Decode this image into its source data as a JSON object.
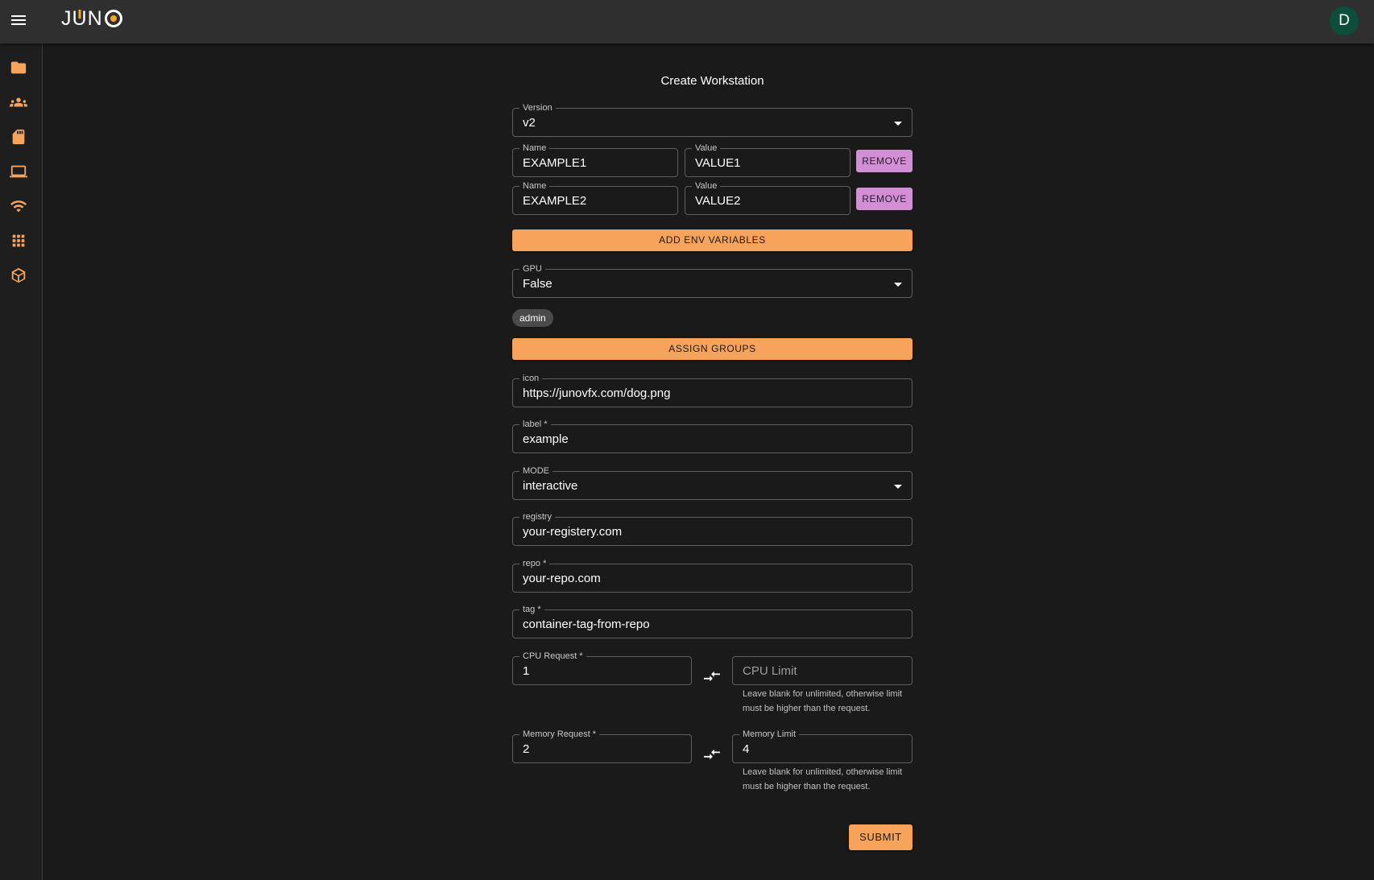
{
  "app": {
    "logo_text": "JUNO",
    "avatar_initial": "D"
  },
  "sidebar": {
    "items": [
      {
        "icon": "folder-icon"
      },
      {
        "icon": "groups-icon"
      },
      {
        "icon": "sd-card-icon"
      },
      {
        "icon": "laptop-icon"
      },
      {
        "icon": "wifi-icon"
      },
      {
        "icon": "apps-grid-icon"
      },
      {
        "icon": "package-icon"
      }
    ],
    "icon_color": "#f7a35c"
  },
  "form": {
    "title": "Create Workstation",
    "version": {
      "label": "Version",
      "value": "v2"
    },
    "env": [
      {
        "name_label": "Name",
        "name": "EXAMPLE1",
        "value_label": "Value",
        "value": "VALUE1",
        "remove_label": "REMOVE"
      },
      {
        "name_label": "Name",
        "name": "EXAMPLE2",
        "value_label": "Value",
        "value": "VALUE2",
        "remove_label": "REMOVE"
      }
    ],
    "add_env_label": "ADD ENV VARIABLES",
    "gpu": {
      "label": "GPU",
      "value": "False"
    },
    "groups": [
      "admin"
    ],
    "assign_groups_label": "ASSIGN GROUPS",
    "icon": {
      "label": "icon",
      "value": "https://junovfx.com/dog.png"
    },
    "label_field": {
      "label": "label *",
      "value": "example"
    },
    "mode": {
      "label": "MODE",
      "value": "interactive"
    },
    "registry": {
      "label": "registry",
      "value": "your-registery.com"
    },
    "repo": {
      "label": "repo *",
      "value": "your-repo.com"
    },
    "tag": {
      "label": "tag *",
      "value": "container-tag-from-repo"
    },
    "cpu_request": {
      "label": "CPU Request *",
      "value": "1"
    },
    "cpu_limit": {
      "placeholder": "CPU Limit",
      "helper": "Leave blank for unlimited, otherwise limit must be higher than the request."
    },
    "memory_request": {
      "label": "Memory Request *",
      "value": "2"
    },
    "memory_limit": {
      "label": "Memory Limit",
      "value": "4",
      "helper": "Leave blank for unlimited, otherwise limit must be higher than the request."
    },
    "submit_label": "SUBMIT"
  },
  "colors": {
    "accent": "#f7a35c",
    "remove": "#d28fd6",
    "avatar": "#0c4d3b",
    "background": "#1a1a1a"
  }
}
